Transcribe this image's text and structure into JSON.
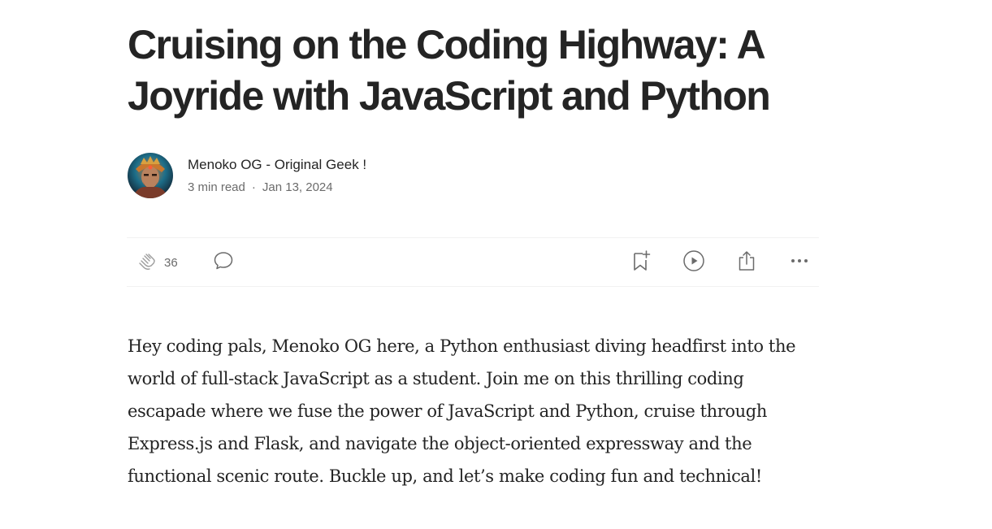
{
  "article": {
    "title": "Cruising on the Coding Highway: A Joyride with JavaScript and Python",
    "author": "Menoko OG - Original Geek !",
    "read_time": "3 min read",
    "separator": "·",
    "date": "Jan 13, 2024",
    "claps": "36",
    "body": "Hey coding pals, Menoko OG here, a Python enthusiast diving headfirst into the world of full-stack JavaScript as a student. Join me on this thrilling coding escapade where we fuse the power of JavaScript and Python, cruise through Express.js and Flask, and navigate the object-oriented expressway and the functional scenic route. Buckle up, and let’s make coding fun and technical!"
  },
  "icons": {
    "clap": "clap-icon",
    "comment": "comment-icon",
    "save": "bookmark-add-icon",
    "listen": "play-icon",
    "share": "share-icon",
    "more": "more-icon"
  },
  "colors": {
    "text": "#242424",
    "muted": "#6b6b6b",
    "divider": "#f2f2f2"
  }
}
